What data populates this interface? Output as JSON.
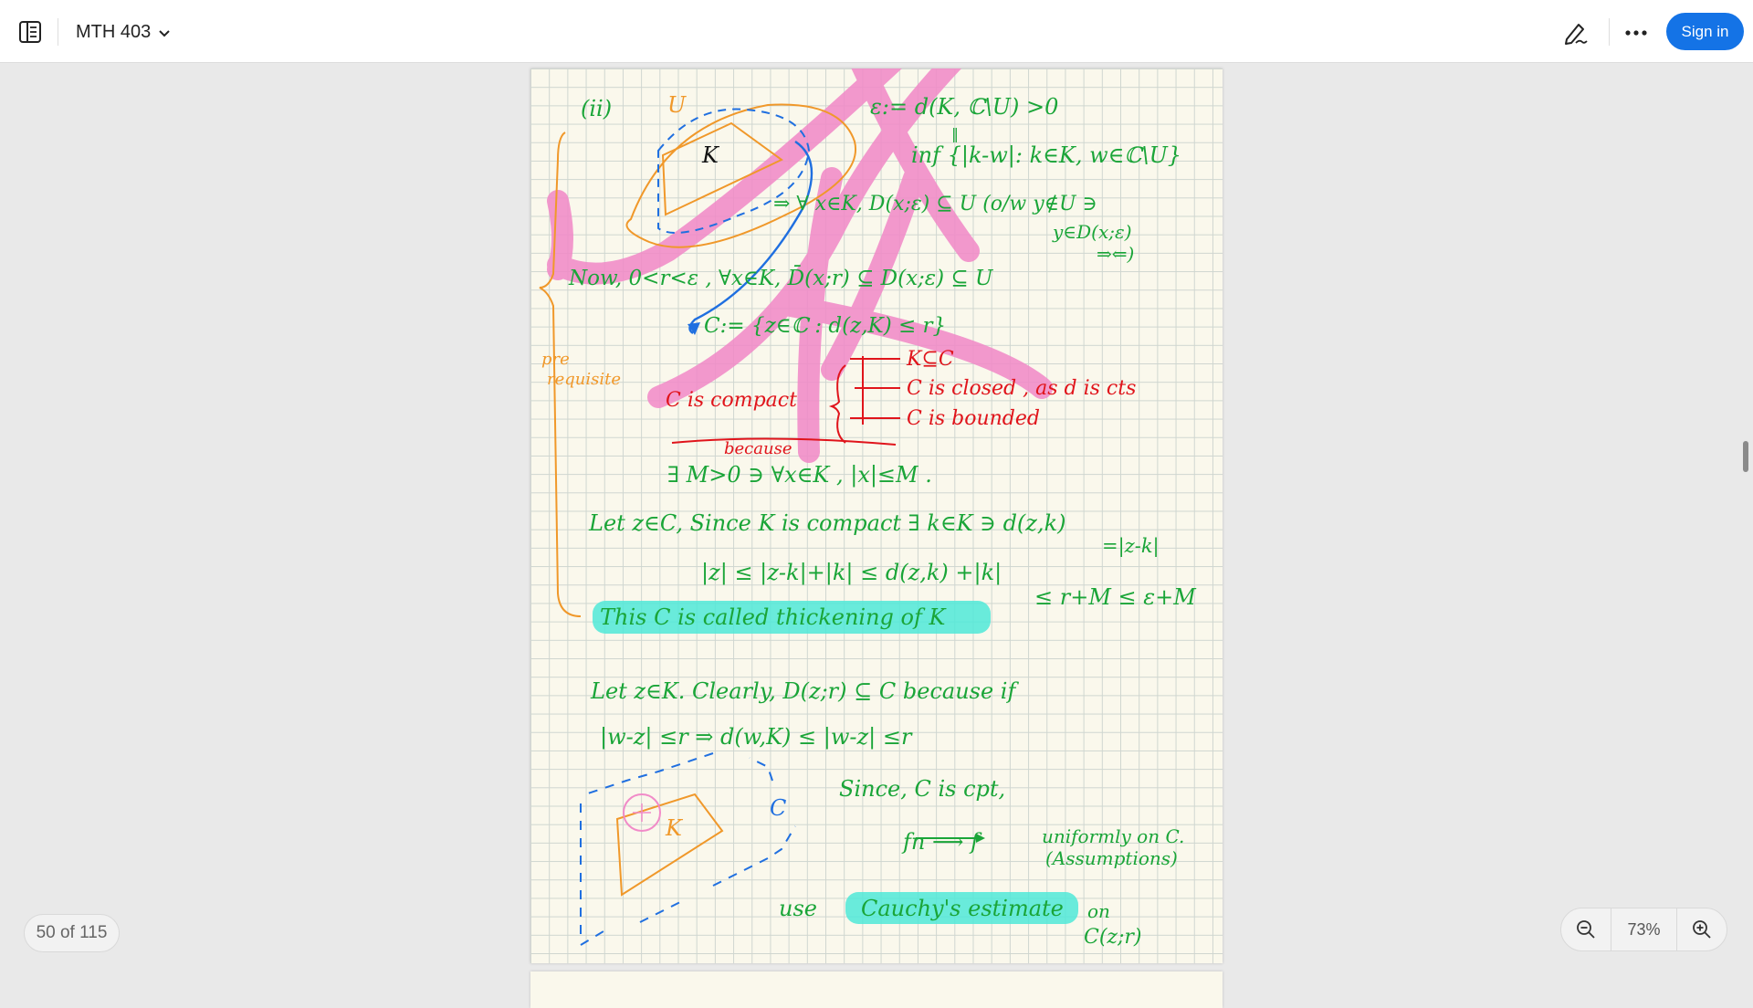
{
  "toolbar": {
    "doc_title": "MTH 403",
    "sign_in_label": "Sign in",
    "icons": {
      "sidebar": "sidebar-toggle-icon",
      "chevron": "chevron-down-icon",
      "annotate": "pen-annotate-icon",
      "more": "more-options-icon"
    }
  },
  "page_counter": "50 of 115",
  "zoom": {
    "level": "73%",
    "zoom_out_icon": "zoom-out-icon",
    "zoom_in_icon": "zoom-in-icon"
  },
  "colors": {
    "accent": "#1473e6",
    "ink_green": "#1aa538",
    "ink_red": "#e0141b",
    "ink_orange": "#f0982a",
    "ink_blue": "#1f6fe0",
    "highlight_pink": "#f18bc8",
    "highlight_cyan": "#4fe9d8"
  },
  "notes": {
    "l_ii": "(ii)",
    "l_U": "U",
    "l_K": "K",
    "l_eps": "ε:= d(K, ℂ\\U) >0",
    "l_eq": "‖",
    "l_inf": "inf {|k-w|: k∈K, w∈ℂ\\U}",
    "l_forall1": "⇒ ∀ x∈K,   D(x;ε) ⊆ U (o/w y∉U ∋",
    "l_forall2": "y∈D(x;ε)",
    "l_forall3": "⇒⇐)",
    "l_now": "Now,  0<r<ε  ,  ∀x∈K, D̄(x;r) ⊆ D(x;ε) ⊆ U",
    "l_cdef": "C:=   {z∈ℂ :  d(z,K) ≤ r}",
    "l_pre1": "pre",
    "l_pre2": "requisite",
    "l_kc": "K⊆C",
    "l_cclosed": "C is closed , as d is cts",
    "l_compact": "C is compact",
    "l_cbounded": "C is bounded",
    "l_because": "because",
    "l_exists": "∃ M>0 ∋ ∀x∈K , |x|≤M .",
    "l_let1": "Let z∈C, Since K is compact  ∃ k∈K ∋ d(z,k)",
    "l_let1b": "=|z-k|",
    "l_ineq": "|z| ≤ |z-k|+|k| ≤  d(z,k) +|k|",
    "l_ineq2": "≤ r+M ≤ ε+M",
    "l_thick": "This C is called thickening of K",
    "l_let2": "Let z∈K. Clearly, D(z;r) ⊆ C because if",
    "l_w": "|w-z| ≤r ⇒ d(w,K) ≤ |w-z| ≤r",
    "l_fig_K": "K",
    "l_fig_C": "C",
    "l_since": "Since, C is cpt,",
    "l_fn": "fn ⟶ f",
    "l_unif": "uniformly on C.",
    "l_assump": "(Assumptions)",
    "l_use": "use",
    "l_cauchy": "Cauchy's estimate",
    "l_on": "on",
    "l_cz": "C(z;r)"
  }
}
